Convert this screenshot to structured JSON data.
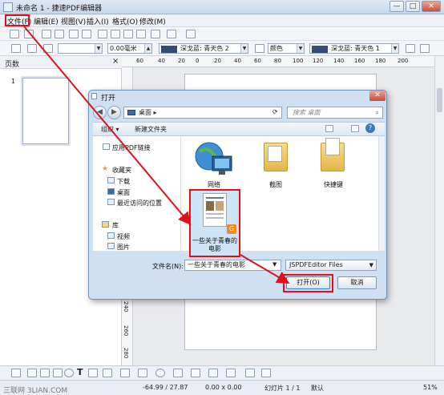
{
  "window": {
    "title": "未命名 1 - 捷速PDF编辑器",
    "controls": [
      "—",
      "□",
      "✕"
    ]
  },
  "menu": [
    {
      "label": "文件(F)"
    },
    {
      "label": "编辑(E)"
    },
    {
      "label": "视图(V)"
    },
    {
      "label": "插入(I)"
    },
    {
      "label": "格式(O)"
    },
    {
      "label": "修改(M)"
    }
  ],
  "toolbar2": {
    "size_value": "0.00毫米",
    "fill_color": "深戈蓝: 青天色 2",
    "fill_mode": "颜色",
    "line_color": "深戈蓝: 青天色 1"
  },
  "pages_panel": {
    "title": "页数",
    "close": "×",
    "page_number": "1"
  },
  "ruler": {
    "h_ticks": [
      "60",
      "40",
      "20",
      "0",
      "20",
      "40",
      "60",
      "80",
      "100",
      "120",
      "140",
      "160",
      "180",
      "200"
    ],
    "v_ticks": [
      "240",
      "260",
      "280"
    ]
  },
  "dialog": {
    "title": "打开",
    "close": "✕",
    "address": "桌面",
    "address_arrow": "▸",
    "search_placeholder": "搜索 桌面",
    "organize": "组织 ▾",
    "new_folder": "新建文件夹",
    "nav": {
      "app_links": "应用PDF链接",
      "favorites": "收藏夹",
      "download": "下载",
      "desktop": "桌面",
      "recent": "最近访问的位置",
      "libraries": "库",
      "videos": "视频",
      "pictures": "图片"
    },
    "items": {
      "network": "网络",
      "screenshots": "截图",
      "shortcut": "快捷键",
      "selected_file": "一些关于青春的电影"
    },
    "filename_label": "文件名(N):",
    "filename_value": "一些关于青春的电影",
    "filetype_value": "JSPDFEditor Files",
    "open_button": "打开(O)",
    "cancel_button": "取消"
  },
  "status": {
    "position": "-64.99 / 27.87",
    "size": "0.00 x 0.00",
    "slide": "幻灯片 1 / 1",
    "layout": "默认",
    "zoom": "51%"
  },
  "watermark": "三联网 3LIAN.COM",
  "colors": {
    "highlight": "#e0101a",
    "dialog_bg": "#cfe0f3",
    "accent": "#2f4f7a"
  }
}
